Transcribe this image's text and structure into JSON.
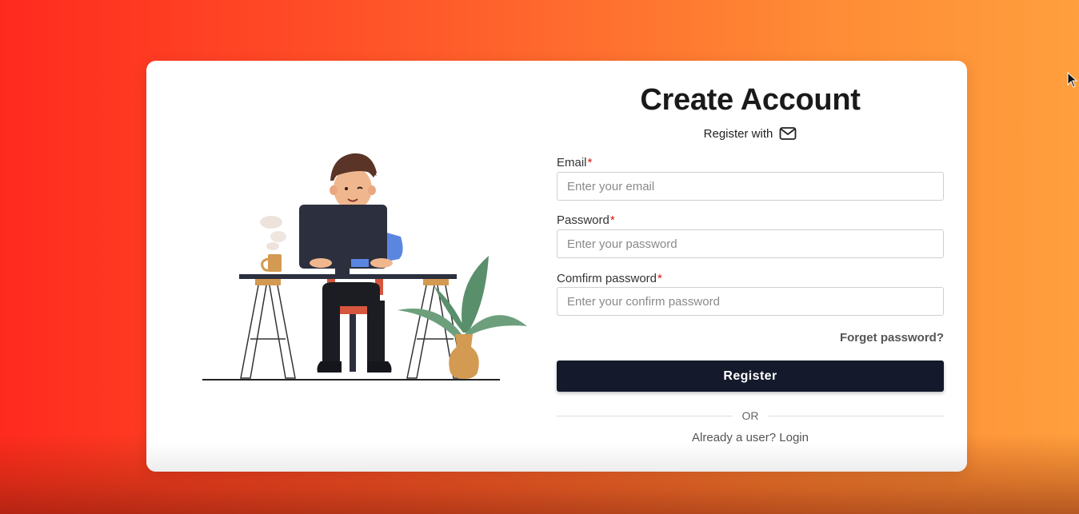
{
  "form": {
    "title": "Create Account",
    "register_with": "Register with",
    "email_label": "Email",
    "email_placeholder": "Enter your email",
    "password_label": "Password",
    "password_placeholder": "Enter your password",
    "confirm_label": "Comfirm password",
    "confirm_placeholder": "Enter your confirm password",
    "required_marker": "*",
    "forget_password": "Forget password?",
    "register_button": "Register",
    "or_text": "OR",
    "already_user": "Already a user?",
    "login_link": "Login"
  },
  "colors": {
    "background_start": "#ff2a1e",
    "background_end": "#ff9f3d",
    "button": "#14192b",
    "required": "#dd1111"
  },
  "icons": {
    "register_with": "mail-icon",
    "cursor": "mouse-pointer-icon"
  }
}
